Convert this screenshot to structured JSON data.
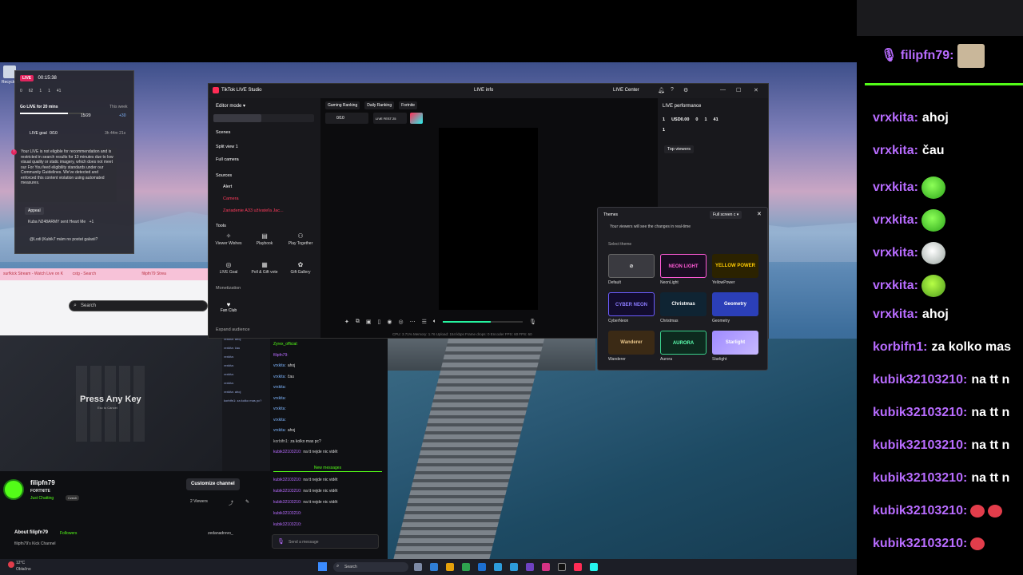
{
  "live_card": {
    "live_label": "LIVE",
    "timer": "00:15:38",
    "stats": [
      "0",
      "62",
      "1",
      "1",
      "41"
    ],
    "goal_title": "Go LIVE for 20 mins",
    "goal_badge": "This week",
    "goal_progress": "15/20",
    "goal_points": "+30",
    "live_goal_label": "LIVE goal",
    "live_goal_value": "0/10",
    "live_goal_time": "3h 44m 21s",
    "warning": "Your LIVE is not eligible for recommendation and is restricted in search results for 10 minutes due to low visual quality or static imagery, which does not meet our For You feed eligibility standards under our Community Guidelines. We've detected and enforced this content violation using automated measures.",
    "appeal_label": "Appeal",
    "gift_line": "Kuba N248ARMY sent Heart Me",
    "gift_count": "+1",
    "chat_line": "@Lodi  |Kubik7 mám no postat galaxii?"
  },
  "browser": {
    "tabs": [
      "surfkick Stream - Watch Live on K",
      "cstg - Search",
      "filipfn79 Strea"
    ],
    "search_placeholder": "Search"
  },
  "studio": {
    "title": "TikTok LIVE Studio",
    "live_info": "LIVE info",
    "live_center": "LIVE Center",
    "editor_mode": "Editor mode",
    "scenes_label": "Scenes",
    "scenes": [
      "Split view 1",
      "Full camera"
    ],
    "sources_label": "Sources",
    "sources": [
      "Alert",
      "Camera",
      "Zariadenie A33 užívateľa Jac..."
    ],
    "tools_label": "Tools",
    "tools": [
      "Viewer Wishes",
      "Playbook",
      "Play Together",
      "LIVE Goal",
      "Poll & Gift vote",
      "Gift Gallery"
    ],
    "monetization_label": "Monetization",
    "fan_club": "Fan Club",
    "expand_audience": "Expand audience",
    "center_tabs": [
      "Gaming Ranking",
      "Daily Ranking",
      "Fortnite"
    ],
    "goal_mini": "0/10",
    "live_fest": "LIVE FEST 25",
    "volume_percent": 60,
    "stats_line": "CPU: 3.71%   Memory: 1.76   Upload: 154 kbps   Frame drops: 0   Encoder FPS: 60   FPS: 60",
    "performance_label": "LIVE performance",
    "perf_stats": [
      "1",
      "USD0.00",
      "0",
      "1",
      "41"
    ],
    "perf_second": "1",
    "top_viewers": "Top viewers"
  },
  "themes": {
    "title": "Themes",
    "dropdown": "Full screen c",
    "note": "Your viewers will see the changes in real-time",
    "select_label": "Select theme",
    "items": [
      {
        "name": "Default",
        "art": ""
      },
      {
        "name": "NeonLight",
        "art": "NEON LIGHT"
      },
      {
        "name": "YellowPower",
        "art": "YELLOW POWER"
      },
      {
        "name": "CyberNeon",
        "art": "CYBER NEON"
      },
      {
        "name": "Christmas",
        "art": "Christmas"
      },
      {
        "name": "Geometry",
        "art": "Geometry"
      },
      {
        "name": "Wanderer",
        "art": "Wanderer"
      },
      {
        "name": "Aurora",
        "art": "AURORA"
      },
      {
        "name": "Starlight",
        "art": "Starlight"
      }
    ]
  },
  "kick": {
    "video_text": "Press Any Key",
    "video_sub": "Esc to Cancel",
    "channel_name": "filipfn79",
    "game": "FORTNITE",
    "category": "Just Chatting",
    "tag": "Czech",
    "customize_label": "Customize channel",
    "viewers": "2 Viewers",
    "about_title": "About filipfn79",
    "followers": "Followers",
    "about_sub": "filipfn79's Kick Channel",
    "tiktok": "zedanadrevo_",
    "chat_messages": [
      {
        "user": "Zyrex_official:",
        "text": "",
        "color": "green"
      },
      {
        "user": "filipfn79:",
        "text": "",
        "color": "purple"
      },
      {
        "user": "vrxkita:",
        "text": "ahoj",
        "color": "blue"
      },
      {
        "user": "vrxkita:",
        "text": "čau",
        "color": "blue"
      },
      {
        "user": "vrxkita:",
        "text": "",
        "color": "blue"
      },
      {
        "user": "vrxkita:",
        "text": "",
        "color": "blue"
      },
      {
        "user": "vrxkita:",
        "text": "",
        "color": "blue"
      },
      {
        "user": "vrxkita:",
        "text": "",
        "color": "blue"
      },
      {
        "user": "vrxkita:",
        "text": "ahoj",
        "color": "blue"
      },
      {
        "user": "korbifn1:",
        "text": "za kolko mas pc?",
        "color": "grey"
      },
      {
        "user": "kubik32103210:",
        "text": "na tt nejde nic vidět",
        "color": "purple"
      }
    ],
    "new_messages": "New messages",
    "chat_messages_2": [
      {
        "user": "kubik32103210:",
        "text": "na tt nejde nic vidět"
      },
      {
        "user": "kubik32103210:",
        "text": "na tt nejde nic vidět"
      },
      {
        "user": "kubik32103210:",
        "text": "na tt nejde nic vidět"
      },
      {
        "user": "kubik32103210:",
        "text": ""
      },
      {
        "user": "kubik32103210:",
        "text": ""
      }
    ],
    "send_placeholder": "Send a message"
  },
  "right_chat": {
    "top_user": "filipfn79:",
    "messages": [
      {
        "user": "vrxkita:",
        "text": "ahoj",
        "emote": ""
      },
      {
        "user": "vrxkita:",
        "text": "čau",
        "emote": ""
      },
      {
        "user": "vrxkita:",
        "text": "",
        "emote": "green"
      },
      {
        "user": "vrxkita:",
        "text": "",
        "emote": "green"
      },
      {
        "user": "vrxkita:",
        "text": "",
        "emote": "white"
      },
      {
        "user": "vrxkita:",
        "text": "",
        "emote": "orange"
      },
      {
        "user": "vrxkita:",
        "text": "ahoj",
        "emote": ""
      },
      {
        "user": "korbifn1:",
        "text": "za kolko mas",
        "emote": ""
      },
      {
        "user": "kubik32103210:",
        "text": "na tt n",
        "emote": ""
      },
      {
        "user": "kubik32103210:",
        "text": "na tt n",
        "emote": ""
      },
      {
        "user": "kubik32103210:",
        "text": "na tt n",
        "emote": ""
      },
      {
        "user": "kubik32103210:",
        "text": "na tt n",
        "emote": ""
      },
      {
        "user": "kubik32103210:",
        "text": "",
        "emote": "red2"
      },
      {
        "user": "kubik32103210:",
        "text": "",
        "emote": "red1"
      }
    ]
  },
  "taskbar": {
    "weather": "12°C",
    "weather_sub": "Oblačno",
    "search_placeholder": "Search"
  },
  "desktop": {
    "recycle_label": "Recycle Bin"
  },
  "colors": {
    "kick_green": "#53fc18",
    "tiktok_pink": "#ff2c55",
    "chat_purple": "#b86cff"
  }
}
